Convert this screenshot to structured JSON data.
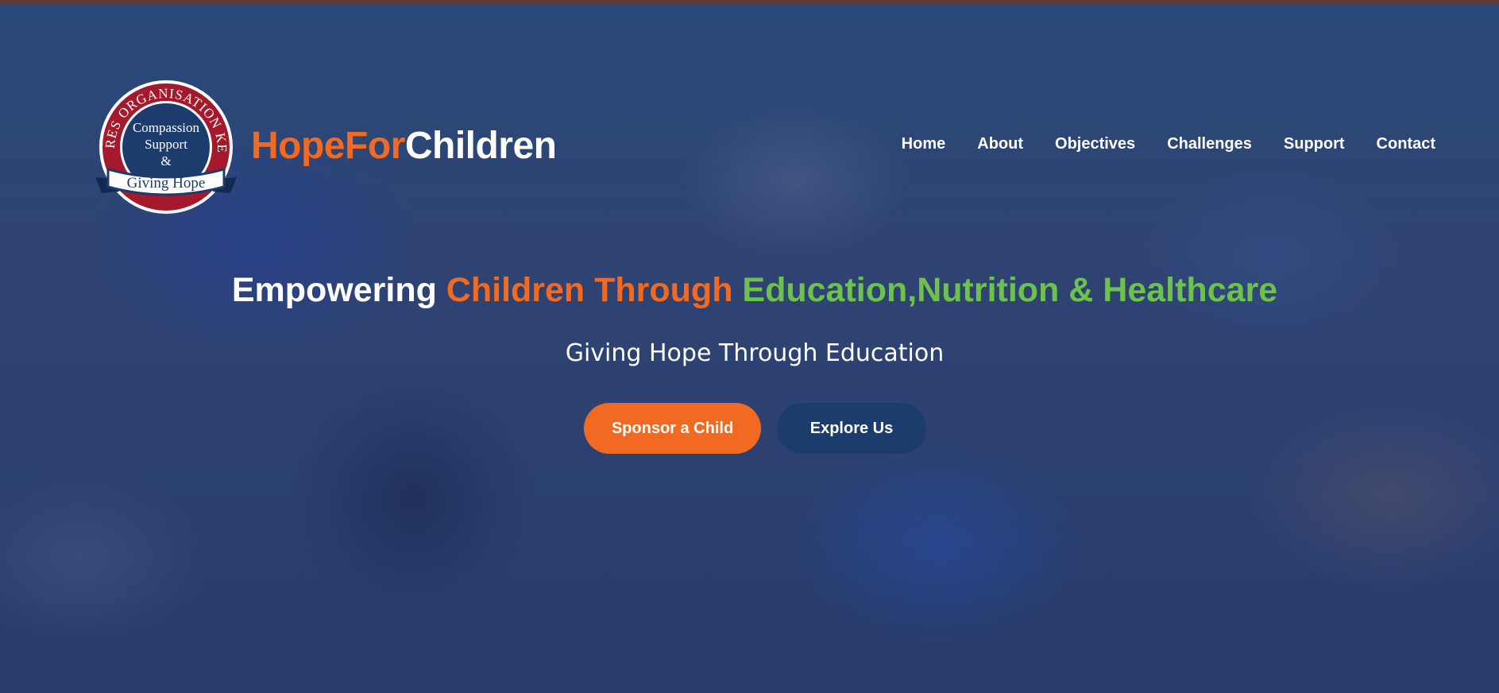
{
  "logo": {
    "ring_text": "CLAIRES ORGANISATION KENYA",
    "inner_line1": "Compassion",
    "inner_line2": "Support",
    "inner_line3": "&",
    "banner": "Giving Hope",
    "ring_color": "#a4192b",
    "inner_color": "#1d3c6e"
  },
  "brand": {
    "part1": "HopeFor",
    "part2": "Children",
    "accent": "#f26a21"
  },
  "nav": {
    "items": [
      {
        "label": "Home"
      },
      {
        "label": "About"
      },
      {
        "label": "Objectives"
      },
      {
        "label": "Challenges"
      },
      {
        "label": "Support"
      },
      {
        "label": "Contact"
      }
    ]
  },
  "hero": {
    "headline_part1": "Empowering ",
    "headline_part2": "Children Through ",
    "headline_part3": "Education,Nutrition & Healthcare",
    "tagline": "Giving Hope Through Education",
    "primary_button": "Sponsor a Child",
    "secondary_button": "Explore Us",
    "colors": {
      "orange": "#f26a21",
      "green": "#6cc24a",
      "navy": "#1d3c6e"
    }
  }
}
